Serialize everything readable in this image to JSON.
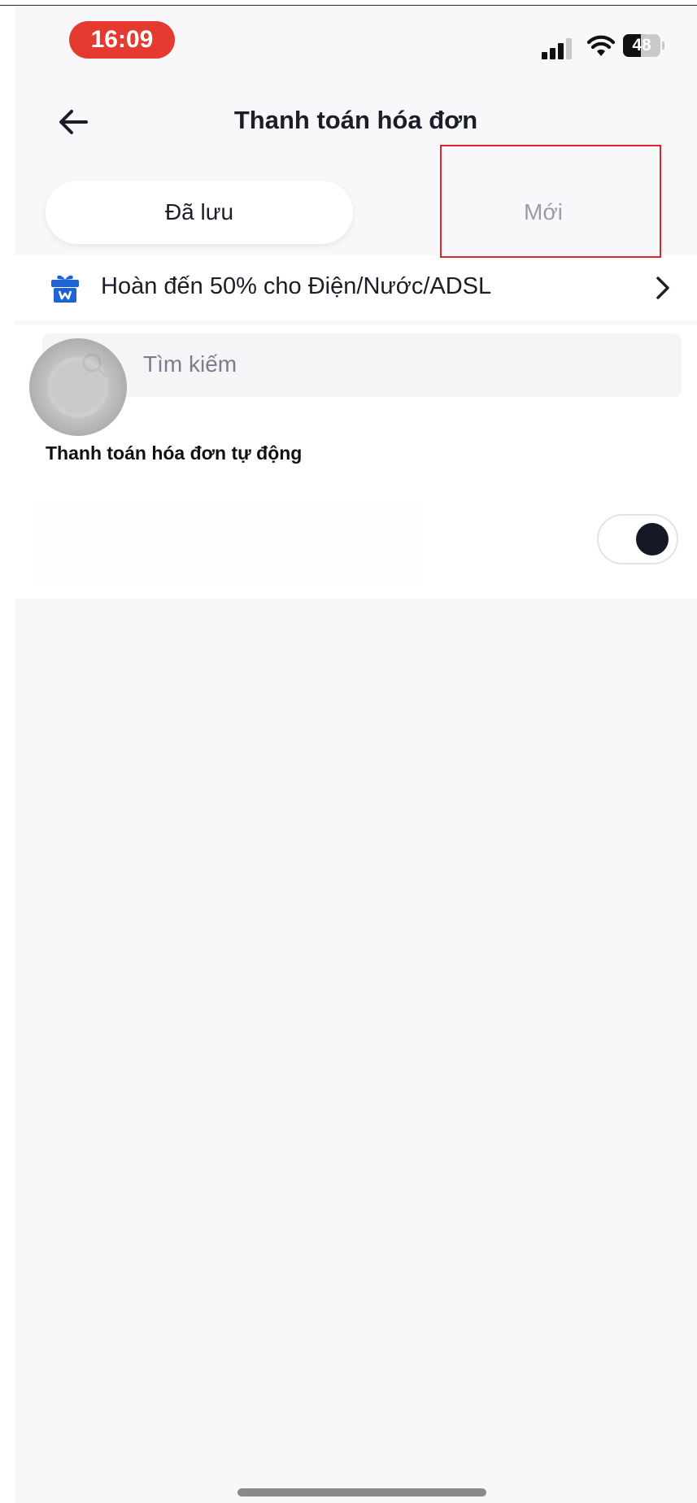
{
  "status_bar": {
    "time": "16:09",
    "battery_level": "48",
    "signal_bars": 3,
    "colors": {
      "time_pill": "#e43a2f"
    }
  },
  "header": {
    "title": "Thanh toán hóa đơn",
    "back_icon": "arrow-left-icon"
  },
  "tabs": [
    {
      "label": "Đã lưu",
      "selected": true
    },
    {
      "label": "Mới",
      "selected": false
    }
  ],
  "promo": {
    "icon": "gift-icon",
    "text": "Hoàn đến 50% cho Điện/Nước/ADSL",
    "chevron": "chevron-right-icon",
    "icon_color": "#1e63d6"
  },
  "search": {
    "placeholder": "Tìm kiếm",
    "icon": "search-icon"
  },
  "auto_payment": {
    "title": "Thanh toán hóa đơn tự động",
    "toggle_on": true
  },
  "colors": {
    "background": "#f8f8fb",
    "highlight_box": "#e0262d",
    "text_primary": "#1b1d29",
    "text_muted": "#9a9cab"
  }
}
